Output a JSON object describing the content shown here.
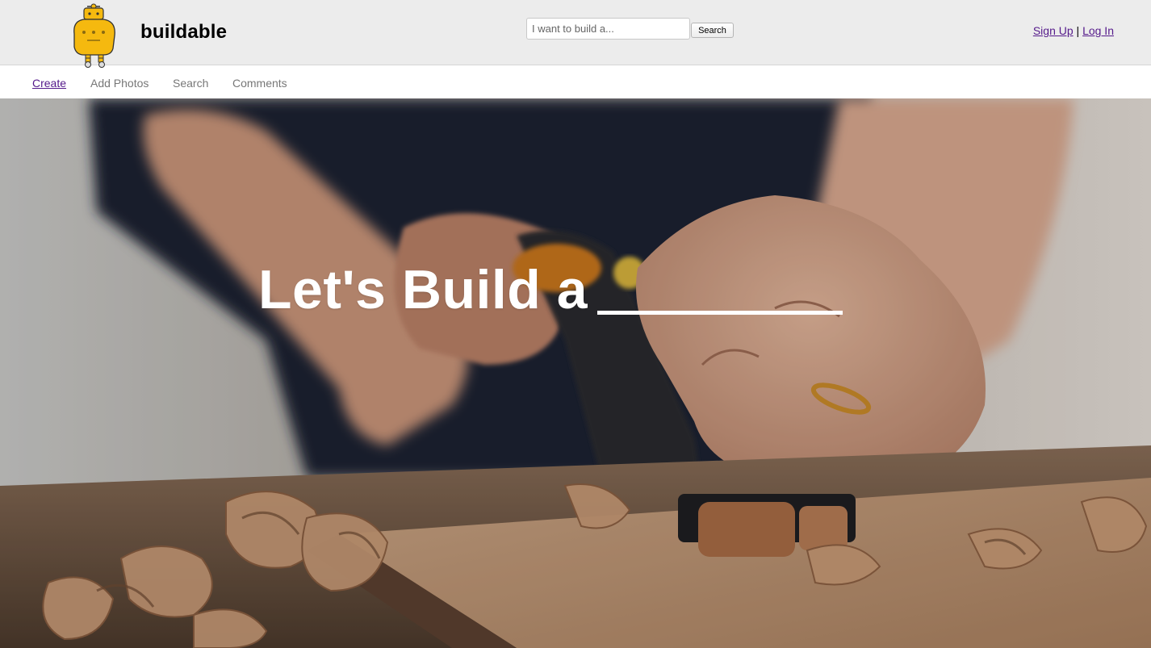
{
  "header": {
    "brand": "buildable",
    "logo_icon": "robot-mascot-icon",
    "search": {
      "placeholder": "I want to build a...",
      "value": "",
      "button_label": "Search"
    },
    "auth": {
      "signup_label": "Sign Up",
      "separator": "|",
      "login_label": "Log In"
    }
  },
  "nav": {
    "items": [
      {
        "label": "Create",
        "active": true
      },
      {
        "label": "Add Photos",
        "active": false
      },
      {
        "label": "Search",
        "active": false
      },
      {
        "label": "Comments",
        "active": false
      }
    ]
  },
  "hero": {
    "headline": "Let's Build a",
    "image_subject": "woodworking-hand-plane-photo"
  },
  "colors": {
    "header_bg": "#ececec",
    "visited_link": "#551a8b",
    "nav_text": "#777777",
    "robot_yellow": "#f5b90f"
  }
}
